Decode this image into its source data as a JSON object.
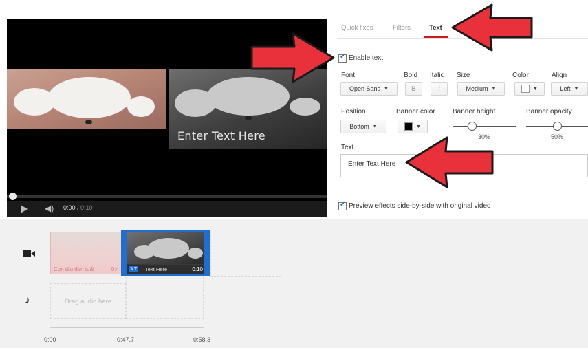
{
  "player": {
    "overlay_text": "Enter Text Here",
    "time_current": "0:00",
    "time_duration": "/ 0:10"
  },
  "tabs": [
    {
      "label": "Quick fixes",
      "active": false
    },
    {
      "label": "Filters",
      "active": false
    },
    {
      "label": "Text",
      "active": true
    }
  ],
  "editor": {
    "enable_text_label": "Enable text",
    "font_label": "Font",
    "font_value": "Open Sans",
    "bold_label": "Bold",
    "bold_glyph": "B",
    "italic_label": "Italic",
    "italic_glyph": "I",
    "size_label": "Size",
    "size_value": "Medium",
    "color_label": "Color",
    "color_value": "#ffffff",
    "align_label": "Align",
    "align_value": "Left",
    "position_label": "Position",
    "position_value": "Bottom",
    "banner_color_label": "Banner color",
    "banner_color_value": "#000000",
    "banner_height_label": "Banner height",
    "banner_height_value": "30%",
    "banner_height_fraction": 0.3,
    "banner_opacity_label": "Banner opacity",
    "banner_opacity_value": "50%",
    "banner_opacity_fraction": 0.5,
    "text_label": "Text",
    "text_value": "Enter Text Here",
    "preview_label": "Preview effects side-by-side with original video"
  },
  "timeline": {
    "clip1_label": "Con tàu đen tuất",
    "clip1_time": "0:4",
    "clip2_label": "Text Here",
    "clip2_time": "0:10",
    "audio_placeholder": "Drag audio here",
    "ticks": [
      "0:00",
      "0:47.7",
      "0:58.3"
    ]
  },
  "colors": {
    "accent_red": "#cc181e",
    "selection_blue": "#1e6fd0",
    "annotation_arrow": "#e8313a"
  }
}
